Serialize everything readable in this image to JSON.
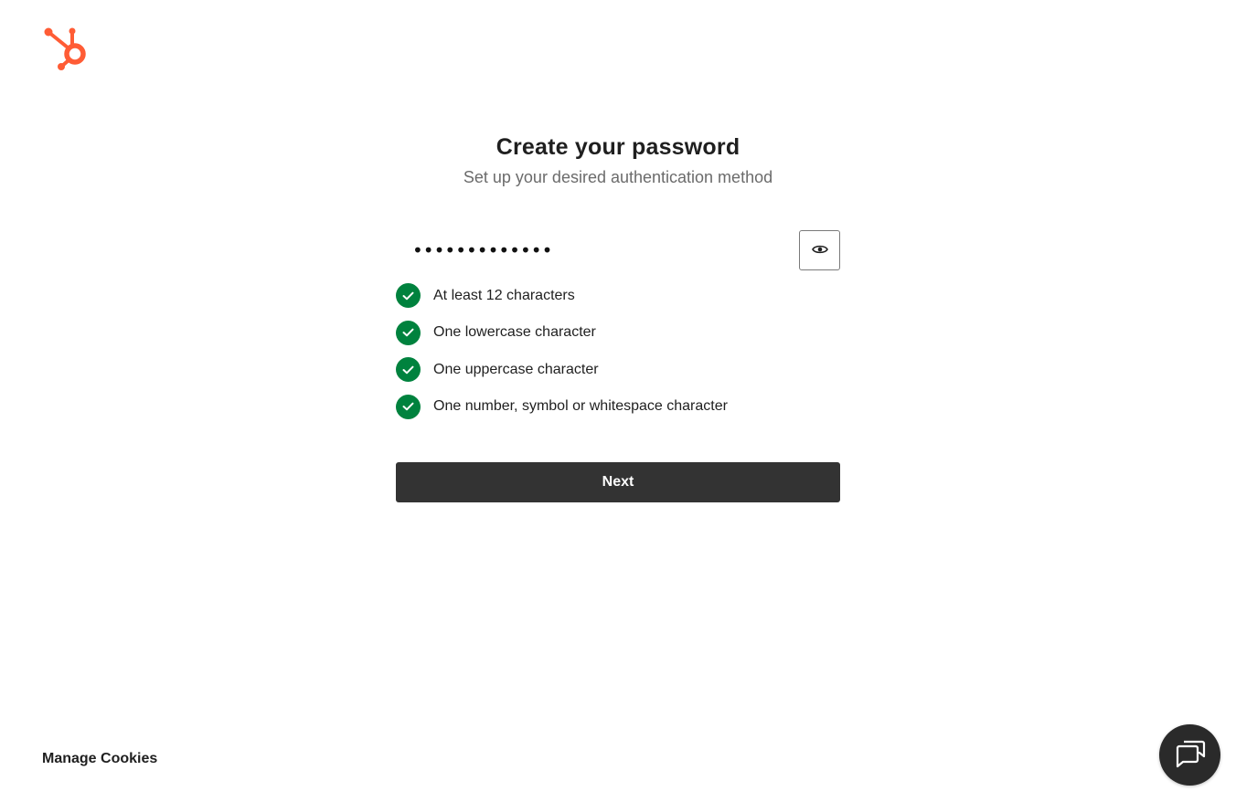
{
  "brand": {
    "logo": "hubspot-sprocket-logo",
    "accent_color": "#ff5c35"
  },
  "header": {
    "title": "Create your password",
    "subtitle": "Set up your desired authentication method"
  },
  "password_field": {
    "value": "•••••••••••••",
    "toggle_icon": "eye-icon"
  },
  "requirements": [
    {
      "label": "At least 12 characters",
      "met": true
    },
    {
      "label": "One lowercase character",
      "met": true
    },
    {
      "label": "One uppercase character",
      "met": true
    },
    {
      "label": "One number, symbol or whitespace character",
      "met": true
    }
  ],
  "actions": {
    "next_label": "Next"
  },
  "footer": {
    "manage_cookies_label": "Manage Cookies",
    "chat_icon": "chat-bubbles-icon"
  },
  "colors": {
    "check_green": "#00823e",
    "button_dark": "#333333",
    "chat_bg": "#2a2a2a"
  }
}
